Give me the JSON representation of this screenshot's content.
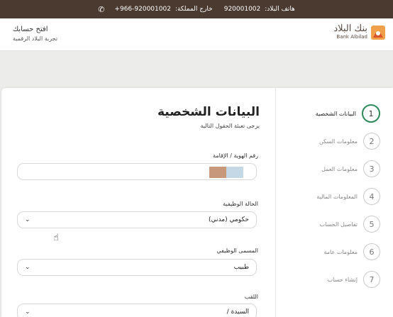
{
  "topbar": {
    "country_phone_label": "هاتف البلاد:",
    "country_phone": "920001002",
    "abroad_label": "خارج المملكة:",
    "abroad_phone": "+966-920001002",
    "icon": "phone-icon"
  },
  "header": {
    "brand_ar": "بنك البلاد",
    "brand_en": "Bank Albilad",
    "open_account": "افتح حسابك",
    "digital_experience": "تجربة البلاد الرقمية"
  },
  "steps": [
    {
      "num": "1",
      "label": "البيانات الشخصية",
      "active": true
    },
    {
      "num": "2",
      "label": "معلومات السكن",
      "active": false
    },
    {
      "num": "3",
      "label": "معلومات العمل",
      "active": false
    },
    {
      "num": "4",
      "label": "المعلومات المالية",
      "active": false
    },
    {
      "num": "5",
      "label": "تفاصيل الحساب",
      "active": false
    },
    {
      "num": "6",
      "label": "معلومات عامة",
      "active": false
    },
    {
      "num": "7",
      "label": "إنشاء حساب",
      "active": false
    }
  ],
  "form": {
    "title": "البيانات الشخصية",
    "subtitle": "يرجى تعبئة الحقول التالية",
    "id_label": "رقم الهوية / الإقامة",
    "employment_label": "الحالة الوظيفية",
    "employment_value": "حكومي (مدني)",
    "job_title_label": "المسمى الوظيفي",
    "job_title_value": "طبيب",
    "title_label": "اللقب",
    "title_value": "السيدة /"
  },
  "colors": {
    "topbar": "#4a3a30",
    "accent_green": "#2c8a5b",
    "logo_orange": "#e8893a",
    "logo_red": "#d9542b"
  }
}
